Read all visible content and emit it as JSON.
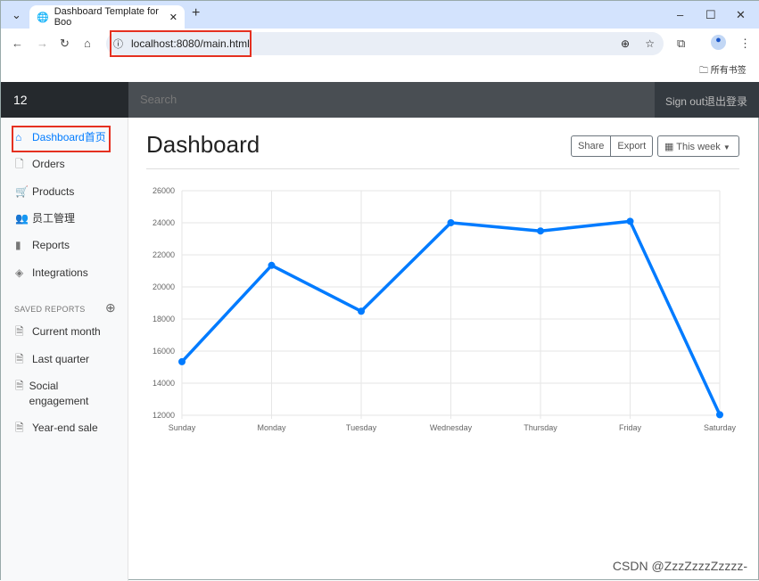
{
  "browser": {
    "tab_title": "Dashboard Template for Boo",
    "url": "localhost:8080/main.html",
    "bookmarks_label": "所有书签"
  },
  "navbar": {
    "brand": "12",
    "search_placeholder": "Search",
    "signout": "Sign out退出登录"
  },
  "sidebar": {
    "items": [
      {
        "label": "Dashboard首页",
        "icon": "home-icon",
        "active": true
      },
      {
        "label": "Orders",
        "icon": "file-icon"
      },
      {
        "label": "Products",
        "icon": "cart-icon"
      },
      {
        "label": "员工管理",
        "icon": "users-icon"
      },
      {
        "label": "Reports",
        "icon": "bar-chart-icon"
      },
      {
        "label": "Integrations",
        "icon": "layers-icon"
      }
    ],
    "saved_heading": "SAVED REPORTS",
    "saved": [
      {
        "label": "Current month"
      },
      {
        "label": "Last quarter"
      },
      {
        "label": "Social engagement"
      },
      {
        "label": "Year-end sale"
      }
    ]
  },
  "main": {
    "title": "Dashboard",
    "share": "Share",
    "export": "Export",
    "period": "This week"
  },
  "accent": "#007bff",
  "watermark": "CSDN @ZzzZzzzZzzzz-",
  "chart_data": {
    "type": "line",
    "categories": [
      "Sunday",
      "Monday",
      "Tuesday",
      "Wednesday",
      "Thursday",
      "Friday",
      "Saturday"
    ],
    "values": [
      15339,
      21345,
      18483,
      24003,
      23489,
      24092,
      12034
    ],
    "ylim": [
      12000,
      26000
    ],
    "yticks": [
      "26000",
      "24000",
      "22000",
      "20000",
      "18000",
      "16000",
      "14000",
      "12000"
    ],
    "grid": true,
    "color": "#007bff"
  }
}
